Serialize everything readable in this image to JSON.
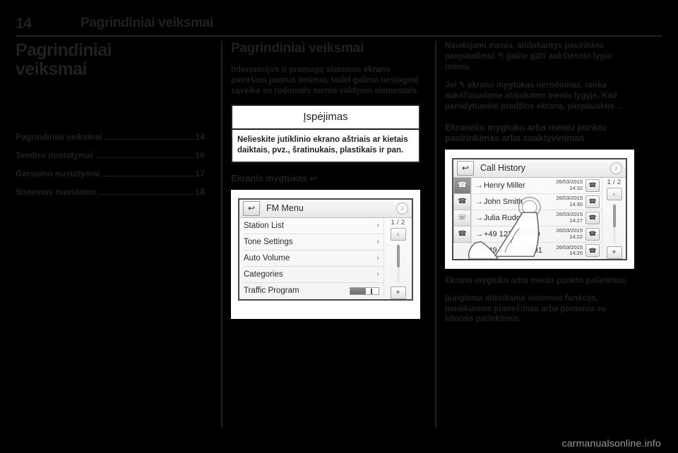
{
  "header": {
    "page_number": "14",
    "title": "Pagrindiniai veiksmai"
  },
  "column_left": {
    "chapter_title_line1": "Pagrindiniai",
    "chapter_title_line2": "veiksmai",
    "toc": [
      {
        "label": "Pagrindiniai veiksmai",
        "page": "14"
      },
      {
        "label": "Tembro nustatymai",
        "page": "16"
      },
      {
        "label": "Garsumo nustatymai",
        "page": "17"
      },
      {
        "label": "Sistemos nuostatos",
        "page": "18"
      }
    ]
  },
  "column_middle": {
    "section_title": "Pagrindiniai veiksmai",
    "intro": "Informacijos ir pramogų sistemos ekrano paviršius jautrus lietimui, todėl galima tiesioginė sąveika su rodomais meniu valdymo elementais.",
    "warning": {
      "title": "Įspėjimas",
      "body": "Nelieskite jutiklinio ekrano aštriais ar kietais daiktais, pvz., šratinukais, plastikais ir pan."
    },
    "subheading": "Ekranis mygtukas",
    "subheading_icon": "back-arrow-icon",
    "figure_fm_menu": {
      "back_icon": "back-arrow-icon",
      "title": "FM Menu",
      "corner_icon": "music-note-icon",
      "page_indicator": "1 / 2",
      "up_icon": "chevron-up-icon",
      "down_icon": "chevron-down-icon",
      "items": [
        {
          "label": "Station List",
          "control": "chevron"
        },
        {
          "label": "Tone Settings",
          "control": "chevron"
        },
        {
          "label": "Auto Volume",
          "control": "chevron"
        },
        {
          "label": "Categories",
          "control": "chevron"
        },
        {
          "label": "Traffic Program",
          "control": "slider"
        }
      ]
    }
  },
  "column_right": {
    "para1": "Naudojami meniu, atitinkantys pasirinkto paspaudimui ↰ galite gįžti aukštesnio lygio meniu.",
    "para2": "Jei ↰ ekrano mygtukas nerodomas, ranka aukščiausiame atitinkamo meniu lygyje. Kad parodytumėte pradžios ekraną, paspauskite ⌂.",
    "subheading": "Ekranėlio mygtuko arba meniu punkto pasirinkimas arba suaktyvinimas",
    "figure_call_history": {
      "back_icon": "back-arrow-icon",
      "title": "Call History",
      "corner_icon": "music-note-icon",
      "page_indicator": "1 / 2",
      "up_icon": "chevron-up-icon",
      "down_icon": "chevron-down-icon",
      "sidebar_tabs": [
        {
          "icon": "all-calls-icon",
          "active": true
        },
        {
          "icon": "incoming-call-icon",
          "active": false
        },
        {
          "icon": "missed-call-icon",
          "active": false
        },
        {
          "icon": "outgoing-call-icon",
          "active": false
        }
      ],
      "rows": [
        {
          "name": "Henry Miller",
          "date": "26/03/2015",
          "time": "14:32",
          "call_icon": "phone-icon"
        },
        {
          "name": "John Smith",
          "date": "26/03/2015",
          "time": "14:30",
          "call_icon": "phone-icon"
        },
        {
          "name": "Julia Rudolff",
          "date": "26/03/2015",
          "time": "14:27",
          "call_icon": "phone-icon"
        },
        {
          "name": "+49 123 456789",
          "date": "26/03/2015",
          "time": "14:22",
          "call_icon": "phone-icon"
        },
        {
          "name": "+49 1234567891",
          "date": "26/03/2015",
          "time": "14:20",
          "call_icon": "phone-icon"
        }
      ],
      "overlay": "hand-finger-touch-illustration"
    },
    "caption1": "Ekrano mygtuko arba meniu punkto palietimas.",
    "caption2": "Įjungiama atitinkama sistemos funkcija, pateikiamas pranešimas arba pomeniu su kitomis parinktimis."
  },
  "footer": {
    "watermark": "carmanualsonline.info"
  },
  "colors": {
    "ink": "#231f20",
    "background": "#000000",
    "paper": "#ffffff",
    "watermark": "#9a9a9a"
  }
}
